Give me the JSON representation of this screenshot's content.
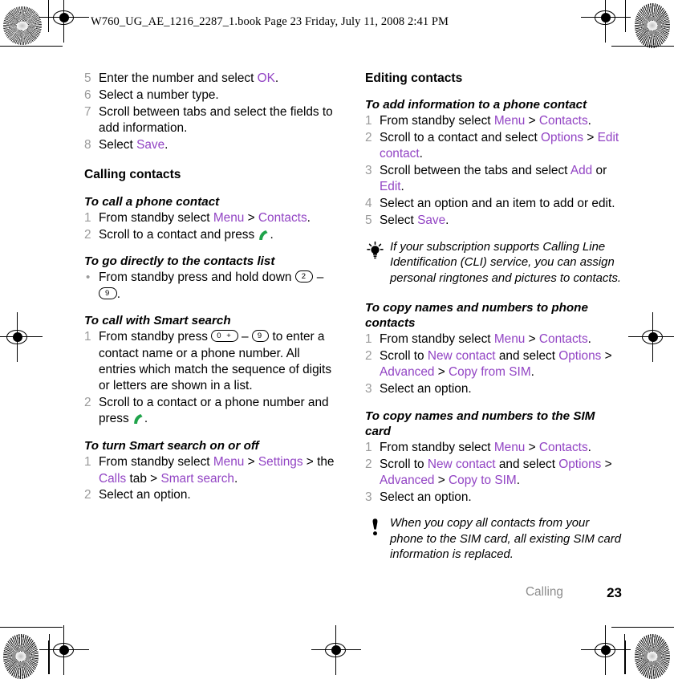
{
  "document": {
    "header_line": "W760_UG_AE_1216_2287_1.book  Page 23  Friday, July 11, 2008  2:41 PM",
    "footer_chapter": "Calling",
    "footer_page_number": "23"
  },
  "colors": {
    "ui_term_purple": "#9244c4",
    "step_number_gray": "#9a9a9a",
    "chapter_gray": "#8d8d8d",
    "call_key_green": "#1fa34a",
    "body_black": "#000000"
  },
  "left_column": {
    "continued_steps": {
      "items": [
        {
          "num": "5",
          "parts": [
            {
              "t": "Enter the number and select ",
              "s": "blk"
            },
            {
              "t": "OK",
              "s": "ui"
            },
            {
              "t": ".",
              "s": "blk"
            }
          ]
        },
        {
          "num": "6",
          "parts": [
            {
              "t": "Select a number type.",
              "s": "blk"
            }
          ]
        },
        {
          "num": "7",
          "parts": [
            {
              "t": "Scroll between tabs and select the fields to add information.",
              "s": "blk"
            }
          ]
        },
        {
          "num": "8",
          "parts": [
            {
              "t": "Select ",
              "s": "blk"
            },
            {
              "t": "Save",
              "s": "ui"
            },
            {
              "t": ".",
              "s": "blk"
            }
          ]
        }
      ]
    },
    "section_heading": "Calling contacts",
    "task_call_phone_contact": {
      "title": "To call a phone contact",
      "items": [
        {
          "num": "1",
          "parts": [
            {
              "t": "From standby select ",
              "s": "blk"
            },
            {
              "t": "Menu",
              "s": "ui"
            },
            {
              "t": " > ",
              "s": "blk"
            },
            {
              "t": "Contacts",
              "s": "ui"
            },
            {
              "t": ".",
              "s": "blk"
            }
          ]
        },
        {
          "num": "2",
          "parts": [
            {
              "t": "Scroll to a contact and press ",
              "s": "blk"
            },
            {
              "t": "",
              "s": "call-icon"
            },
            {
              "t": ".",
              "s": "blk"
            }
          ]
        }
      ]
    },
    "task_go_directly": {
      "title": "To go directly to the contacts list",
      "items": [
        {
          "num": "•",
          "parts": [
            {
              "t": "From standby press and hold down ",
              "s": "blk"
            },
            {
              "t": "2",
              "s": "key"
            },
            {
              "t": " – ",
              "s": "blk"
            },
            {
              "t": "9",
              "s": "key"
            },
            {
              "t": ".",
              "s": "blk"
            }
          ]
        }
      ]
    },
    "task_smart_search_call": {
      "title": "To call with Smart search",
      "items": [
        {
          "num": "1",
          "parts": [
            {
              "t": "From standby press ",
              "s": "blk"
            },
            {
              "t": "0 +",
              "s": "key-wide"
            },
            {
              "t": " – ",
              "s": "blk"
            },
            {
              "t": "9",
              "s": "key-wide"
            },
            {
              "t": " to enter a contact name or a phone number. All entries which match the sequence of digits or letters are shown in a list.",
              "s": "blk"
            }
          ]
        },
        {
          "num": "2",
          "parts": [
            {
              "t": "Scroll to a contact or a phone number and press ",
              "s": "blk"
            },
            {
              "t": "",
              "s": "call-icon"
            },
            {
              "t": ".",
              "s": "blk"
            }
          ]
        }
      ]
    },
    "task_smart_search_toggle": {
      "title": "To turn Smart search on or off",
      "items": [
        {
          "num": "1",
          "parts": [
            {
              "t": "From standby select ",
              "s": "blk"
            },
            {
              "t": "Menu",
              "s": "ui"
            },
            {
              "t": " > ",
              "s": "blk"
            },
            {
              "t": "Settings",
              "s": "ui"
            },
            {
              "t": " > the ",
              "s": "blk"
            },
            {
              "t": "Calls",
              "s": "ui"
            },
            {
              "t": " tab > ",
              "s": "blk"
            },
            {
              "t": "Smart search",
              "s": "ui"
            },
            {
              "t": ".",
              "s": "blk"
            }
          ]
        },
        {
          "num": "2",
          "parts": [
            {
              "t": "Select an option.",
              "s": "blk"
            }
          ]
        }
      ]
    }
  },
  "right_column": {
    "section_heading": "Editing contacts",
    "task_add_info": {
      "title": "To add information to a phone contact",
      "items": [
        {
          "num": "1",
          "parts": [
            {
              "t": "From standby select ",
              "s": "blk"
            },
            {
              "t": "Menu",
              "s": "ui"
            },
            {
              "t": " > ",
              "s": "blk"
            },
            {
              "t": "Contacts",
              "s": "ui"
            },
            {
              "t": ".",
              "s": "blk"
            }
          ]
        },
        {
          "num": "2",
          "parts": [
            {
              "t": "Scroll to a contact and select ",
              "s": "blk"
            },
            {
              "t": "Options",
              "s": "ui"
            },
            {
              "t": " > ",
              "s": "blk"
            },
            {
              "t": "Edit contact",
              "s": "ui"
            },
            {
              "t": ".",
              "s": "blk"
            }
          ]
        },
        {
          "num": "3",
          "parts": [
            {
              "t": "Scroll between the tabs and select ",
              "s": "blk"
            },
            {
              "t": "Add",
              "s": "ui"
            },
            {
              "t": " or ",
              "s": "blk"
            },
            {
              "t": "Edit",
              "s": "ui"
            },
            {
              "t": ".",
              "s": "blk"
            }
          ]
        },
        {
          "num": "4",
          "parts": [
            {
              "t": "Select an option and an item to add or edit.",
              "s": "blk"
            }
          ]
        },
        {
          "num": "5",
          "parts": [
            {
              "t": "Select ",
              "s": "blk"
            },
            {
              "t": "Save",
              "s": "ui"
            },
            {
              "t": ".",
              "s": "blk"
            }
          ]
        }
      ]
    },
    "tip_note": {
      "icon": "lightbulb-tip-icon",
      "text": "If your subscription supports Calling Line Identification (CLI) service, you can assign personal ringtones and pictures to contacts."
    },
    "task_copy_to_phone": {
      "title": "To copy names and numbers to phone contacts",
      "items": [
        {
          "num": "1",
          "parts": [
            {
              "t": "From standby select ",
              "s": "blk"
            },
            {
              "t": "Menu",
              "s": "ui"
            },
            {
              "t": " > ",
              "s": "blk"
            },
            {
              "t": "Contacts",
              "s": "ui"
            },
            {
              "t": ".",
              "s": "blk"
            }
          ]
        },
        {
          "num": "2",
          "parts": [
            {
              "t": "Scroll to ",
              "s": "blk"
            },
            {
              "t": "New contact",
              "s": "ui"
            },
            {
              "t": " and select ",
              "s": "blk"
            },
            {
              "t": "Options",
              "s": "ui"
            },
            {
              "t": " > ",
              "s": "blk"
            },
            {
              "t": "Advanced",
              "s": "ui"
            },
            {
              "t": " > ",
              "s": "blk"
            },
            {
              "t": "Copy from SIM",
              "s": "ui"
            },
            {
              "t": ".",
              "s": "blk"
            }
          ]
        },
        {
          "num": "3",
          "parts": [
            {
              "t": "Select an option.",
              "s": "blk"
            }
          ]
        }
      ]
    },
    "task_copy_to_sim": {
      "title": "To copy names and numbers to the SIM card",
      "items": [
        {
          "num": "1",
          "parts": [
            {
              "t": "From standby select ",
              "s": "blk"
            },
            {
              "t": "Menu",
              "s": "ui"
            },
            {
              "t": " > ",
              "s": "blk"
            },
            {
              "t": "Contacts",
              "s": "ui"
            },
            {
              "t": ".",
              "s": "blk"
            }
          ]
        },
        {
          "num": "2",
          "parts": [
            {
              "t": "Scroll to ",
              "s": "blk"
            },
            {
              "t": "New contact",
              "s": "ui"
            },
            {
              "t": " and select ",
              "s": "blk"
            },
            {
              "t": "Options",
              "s": "ui"
            },
            {
              "t": " > ",
              "s": "blk"
            },
            {
              "t": "Advanced",
              "s": "ui"
            },
            {
              "t": " > ",
              "s": "blk"
            },
            {
              "t": "Copy to SIM",
              "s": "ui"
            },
            {
              "t": ".",
              "s": "blk"
            }
          ]
        },
        {
          "num": "3",
          "parts": [
            {
              "t": "Select an option.",
              "s": "blk"
            }
          ]
        }
      ]
    },
    "warning_note": {
      "icon": "exclamation-warning-icon",
      "text": "When you copy all contacts from your phone to the SIM card, all existing SIM card information is replaced."
    }
  }
}
